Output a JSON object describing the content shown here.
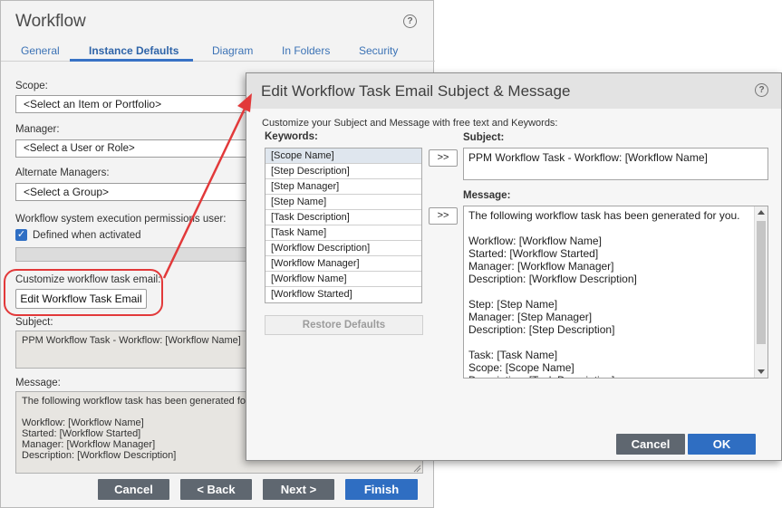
{
  "workflow": {
    "title": "Workflow",
    "help_glyph": "?",
    "tabs": [
      "General",
      "Instance Defaults",
      "Diagram",
      "In Folders",
      "Security"
    ],
    "active_tab": "Instance Defaults",
    "scope_label": "Scope:",
    "scope_value": "<Select an Item or Portfolio>",
    "manager_label": "Manager:",
    "manager_value": "<Select a User or Role>",
    "alt_managers_label": "Alternate Managers:",
    "alt_managers_value": "<Select a Group>",
    "perm_label": "Workflow system execution permissions user:",
    "defined_when_activated": "Defined when activated",
    "customize_label": "Customize workflow task email:",
    "edit_email_button": "Edit Workflow Task Email",
    "subject_label": "Subject:",
    "subject_value": "PPM Workflow Task - Workflow: [Workflow Name]",
    "message_label": "Message:",
    "message_value": "The following workflow task has been generated fo\n\nWorkflow: [Workflow Name]\nStarted: [Workflow Started]\nManager: [Workflow Manager]\nDescription: [Workflow Description]",
    "buttons": {
      "cancel": "Cancel",
      "back": "< Back",
      "next": "Next >",
      "finish": "Finish"
    }
  },
  "dialog": {
    "title": "Edit Workflow Task Email Subject & Message",
    "help_glyph": "?",
    "instructions": "Customize your Subject and Message with free text and Keywords:",
    "keywords_label": "Keywords:",
    "keywords": [
      "[Scope Name]",
      "[Step Description]",
      "[Step Manager]",
      "[Step Name]",
      "[Task Description]",
      "[Task Name]",
      "[Workflow Description]",
      "[Workflow Manager]",
      "[Workflow Name]",
      "[Workflow Started]"
    ],
    "selected_keyword": "[Scope Name]",
    "insert_button": ">>",
    "restore_defaults": "Restore Defaults",
    "subject_label": "Subject:",
    "subject_value": "PPM Workflow Task - Workflow: [Workflow Name]",
    "message_label": "Message:",
    "message_value": "The following workflow task has been generated for you.\n\nWorkflow: [Workflow Name]\nStarted: [Workflow Started]\nManager: [Workflow Manager]\nDescription: [Workflow Description]\n\nStep: [Step Name]\nManager: [Step Manager]\nDescription: [Step Description]\n\nTask: [Task Name]\nScope: [Scope Name]\nDescription: [Task Description]",
    "buttons": {
      "cancel": "Cancel",
      "ok": "OK"
    }
  },
  "colors": {
    "accent_blue": "#2f6ec2",
    "dark_button": "#5f6770",
    "callout_red": "#e2393a"
  }
}
